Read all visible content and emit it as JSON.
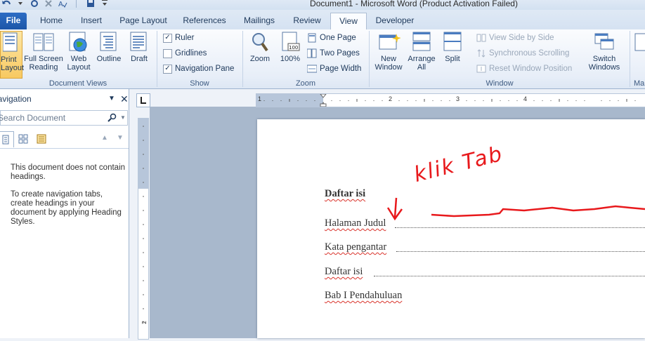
{
  "window": {
    "title": "Document1  -  Microsoft Word (Product Activation Failed)"
  },
  "tabs": [
    {
      "label": "File"
    },
    {
      "label": "Home"
    },
    {
      "label": "Insert"
    },
    {
      "label": "Page Layout"
    },
    {
      "label": "References"
    },
    {
      "label": "Mailings"
    },
    {
      "label": "Review"
    },
    {
      "label": "View"
    },
    {
      "label": "Developer"
    }
  ],
  "ribbon": {
    "document_views": {
      "label": "Document Views",
      "print_layout": "Print\nLayout",
      "full_screen_reading": "Full Screen\nReading",
      "web_layout": "Web\nLayout",
      "outline": "Outline",
      "draft": "Draft"
    },
    "show": {
      "label": "Show",
      "ruler": "Ruler",
      "gridlines": "Gridlines",
      "navigation_pane": "Navigation Pane"
    },
    "zoom": {
      "label": "Zoom",
      "zoom": "Zoom",
      "hundred": "100%",
      "one_page": "One Page",
      "two_pages": "Two Pages",
      "page_width": "Page Width"
    },
    "window": {
      "label": "Window",
      "new_window": "New\nWindow",
      "arrange_all": "Arrange\nAll",
      "split": "Split",
      "view_side_by_side": "View Side by Side",
      "synchronous_scrolling": "Synchronous Scrolling",
      "reset_window_position": "Reset Window Position",
      "switch_windows": "Switch\nWindows"
    },
    "macros_partial": "Ma"
  },
  "navigation": {
    "title": "Navigation",
    "search_placeholder": "Search Document",
    "message1": "This document does not contain headings.",
    "message2": "To create navigation tabs, create headings in your document by applying Heading Styles."
  },
  "ruler": {
    "numbers": [
      "1",
      "2",
      "3",
      "4"
    ]
  },
  "document": {
    "heading": "Daftar isi",
    "lines": [
      "Halaman Judul",
      "Kata pengantar",
      "Daftar isi",
      "Bab I Pendahuluan"
    ]
  },
  "annotation": {
    "text": "klik Tab",
    "color": "#e8191c"
  }
}
